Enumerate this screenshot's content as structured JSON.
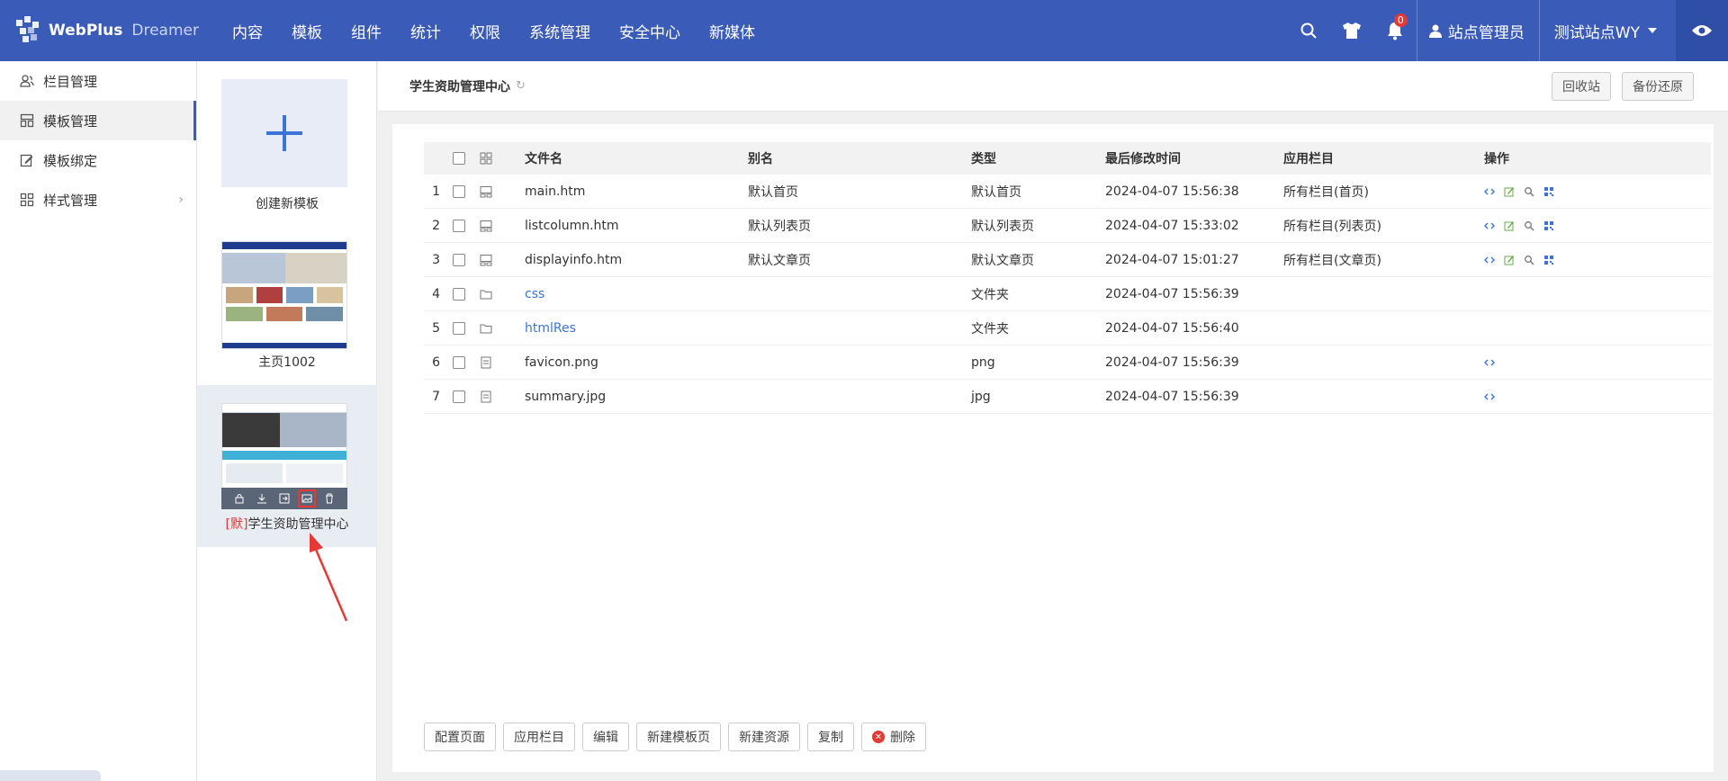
{
  "app": {
    "logo_name": "WebPlus",
    "logo_sub": "Dreamer"
  },
  "nav": [
    "内容",
    "模板",
    "组件",
    "统计",
    "权限",
    "系统管理",
    "安全中心",
    "新媒体"
  ],
  "topright": {
    "notification_count": "0",
    "user_label": "站点管理员",
    "site_label": "测试站点WY"
  },
  "sidebar": {
    "items": [
      {
        "label": "栏目管理",
        "icon": "users-icon"
      },
      {
        "label": "模板管理",
        "icon": "layout-icon"
      },
      {
        "label": "模板绑定",
        "icon": "edit-icon"
      },
      {
        "label": "样式管理",
        "icon": "grid-icon"
      }
    ]
  },
  "templates": {
    "create_label": "创建新模板",
    "items": [
      {
        "label": "主页1002",
        "default": false
      },
      {
        "default_tag": "[默]",
        "label": "学生资助管理中心",
        "default": true
      }
    ]
  },
  "main": {
    "title": "学生资助管理中心",
    "recycle_label": "回收站",
    "backup_label": "备份还原"
  },
  "table": {
    "headers": {
      "name": "文件名",
      "alias": "别名",
      "type": "类型",
      "time": "最后修改时间",
      "column": "应用栏目",
      "ops": "操作"
    },
    "rows": [
      {
        "no": "1",
        "icon": "template-icon",
        "name": "main.htm",
        "alias": "默认首页",
        "type": "默认首页",
        "time": "2024-04-07 15:56:38",
        "column": "所有栏目(首页)",
        "ops": 4
      },
      {
        "no": "2",
        "icon": "template-icon",
        "name": "listcolumn.htm",
        "alias": "默认列表页",
        "type": "默认列表页",
        "time": "2024-04-07 15:33:02",
        "column": "所有栏目(列表页)",
        "ops": 4
      },
      {
        "no": "3",
        "icon": "template-icon",
        "name": "displayinfo.htm",
        "alias": "默认文章页",
        "type": "默认文章页",
        "time": "2024-04-07 15:01:27",
        "column": "所有栏目(文章页)",
        "ops": 4
      },
      {
        "no": "4",
        "icon": "folder-icon",
        "name": "css",
        "alias": "",
        "type": "文件夹",
        "time": "2024-04-07 15:56:39",
        "column": "",
        "ops": 0
      },
      {
        "no": "5",
        "icon": "folder-icon",
        "name": "htmlRes",
        "alias": "",
        "type": "文件夹",
        "time": "2024-04-07 15:56:40",
        "column": "",
        "ops": 0
      },
      {
        "no": "6",
        "icon": "file-icon",
        "name": "favicon.png",
        "alias": "",
        "type": "png",
        "time": "2024-04-07 15:56:39",
        "column": "",
        "ops": 1
      },
      {
        "no": "7",
        "icon": "file-icon",
        "name": "summary.jpg",
        "alias": "",
        "type": "jpg",
        "time": "2024-04-07 15:56:39",
        "column": "",
        "ops": 1
      }
    ]
  },
  "bottom_buttons": [
    "配置页面",
    "应用栏目",
    "编辑",
    "新建模板页",
    "新建资源",
    "复制",
    "删除"
  ],
  "colors": {
    "primary": "#3b5bb8",
    "link": "#3b74d6",
    "danger": "#e53935"
  }
}
